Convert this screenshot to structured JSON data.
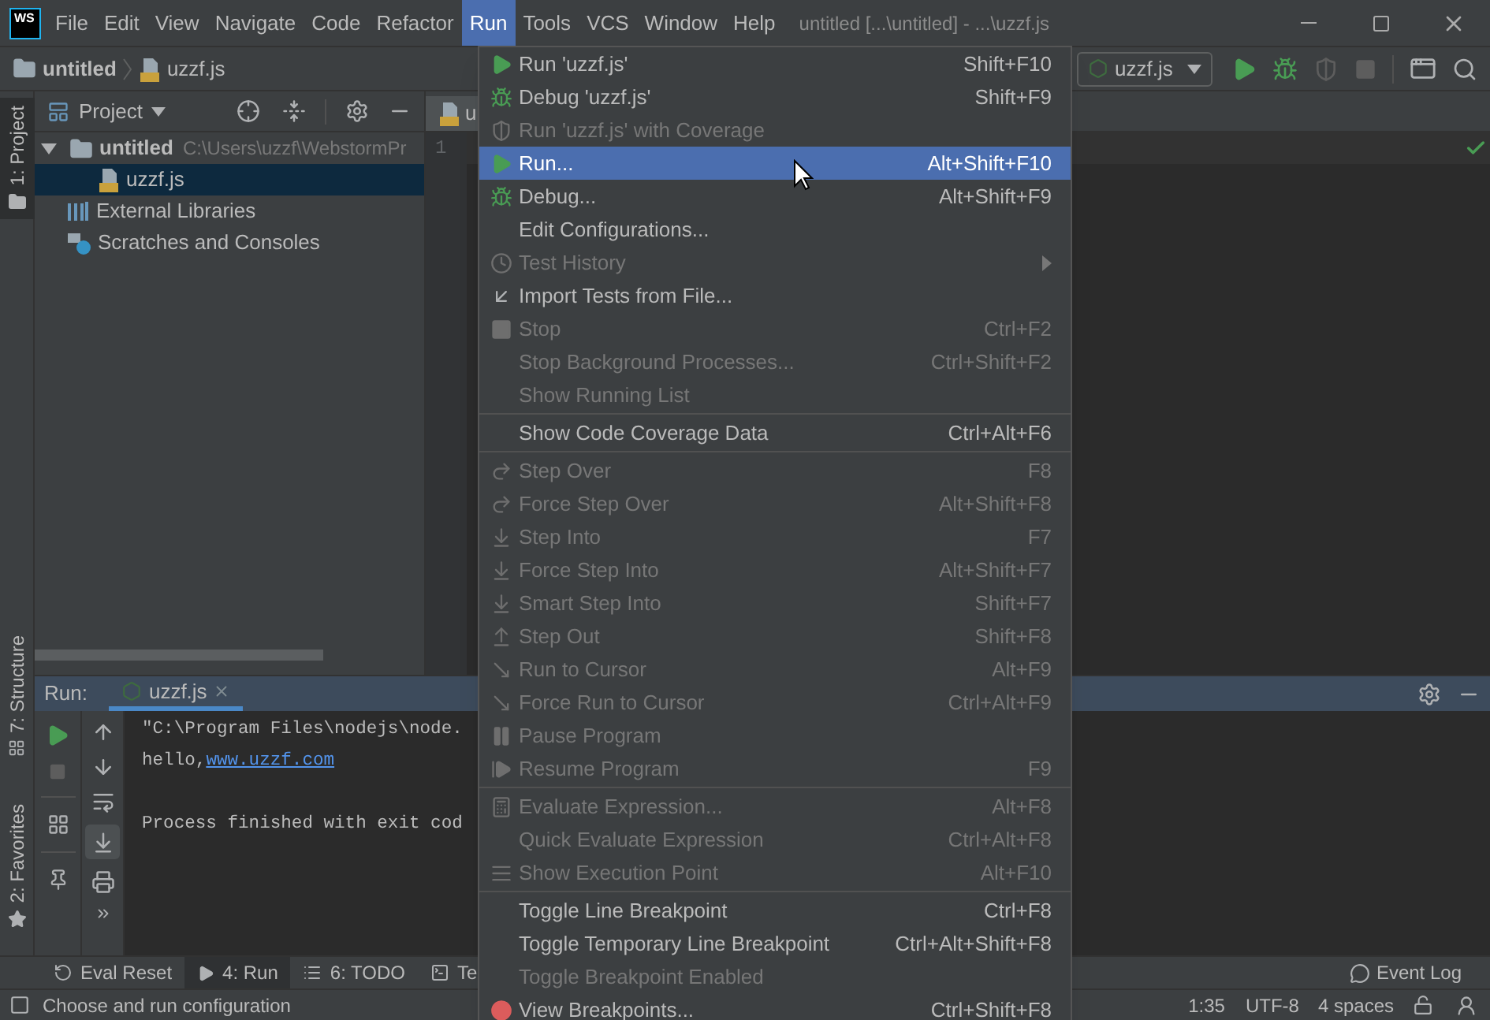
{
  "title_bar": {
    "logo": "WS",
    "menus": [
      {
        "label": "File",
        "selected": false
      },
      {
        "label": "Edit",
        "selected": false
      },
      {
        "label": "View",
        "selected": false
      },
      {
        "label": "Navigate",
        "selected": false
      },
      {
        "label": "Code",
        "selected": false
      },
      {
        "label": "Refactor",
        "selected": false
      },
      {
        "label": "Run",
        "selected": true
      },
      {
        "label": "Tools",
        "selected": false
      },
      {
        "label": "VCS",
        "selected": false
      },
      {
        "label": "Window",
        "selected": false
      },
      {
        "label": "Help",
        "selected": false
      }
    ],
    "title": "untitled [...\\untitled] - ...\\uzzf.js"
  },
  "nav_bar": {
    "breadcrumbs": [
      "untitled",
      "uzzf.js"
    ],
    "run_config": "uzzf.js"
  },
  "tool_strip": [
    {
      "label": "1: Project",
      "selected": true
    },
    {
      "label": "7: Structure",
      "selected": false
    },
    {
      "label": "2: Favorites",
      "selected": false
    }
  ],
  "project_panel": {
    "title": "Project",
    "tree": [
      {
        "label": "untitled",
        "path": "C:\\Users\\uzzf\\WebstormPr",
        "expanded": true,
        "selected": false,
        "children": [
          {
            "label": "uzzf.js",
            "selected": true
          }
        ]
      },
      {
        "label": "External Libraries",
        "selected": false
      },
      {
        "label": "Scratches and Consoles",
        "selected": false
      }
    ]
  },
  "editor": {
    "tab": "u",
    "line_numbers": [
      "1"
    ]
  },
  "run_panel": {
    "label": "Run:",
    "tab": "uzzf.js",
    "console": [
      {
        "kind": "text",
        "text": "\"C:\\Program Files\\nodejs\\node."
      },
      {
        "kind": "link",
        "text": "hello,",
        "link": "www.uzzf.com"
      },
      {
        "kind": "blank"
      },
      {
        "kind": "text",
        "text": "Process finished with exit cod"
      }
    ]
  },
  "bottom_bar": {
    "tools": [
      {
        "label": "Eval Reset",
        "selected": false
      },
      {
        "label": "4: Run",
        "selected": true
      },
      {
        "label": "6: TODO",
        "selected": false
      },
      {
        "label": "Te",
        "selected": false
      }
    ],
    "event_log": "Event Log"
  },
  "status_bar": {
    "message": "Choose and run configuration",
    "position": "1:35",
    "encoding": "UTF-8",
    "indent": "4 spaces"
  },
  "run_menu": {
    "sections": [
      {
        "items": [
          {
            "label": "Run 'uzzf.js'",
            "shortcut": "Shift+F10",
            "disabled": false,
            "selected": false,
            "submenu": false
          },
          {
            "label": "Debug 'uzzf.js'",
            "shortcut": "Shift+F9",
            "disabled": false,
            "selected": false,
            "submenu": false
          },
          {
            "label": "Run 'uzzf.js' with Coverage",
            "disabled": true,
            "selected": false,
            "submenu": false
          },
          {
            "label": "Run...",
            "shortcut": "Alt+Shift+F10",
            "disabled": false,
            "selected": true,
            "submenu": false
          },
          {
            "label": "Debug...",
            "shortcut": "Alt+Shift+F9",
            "disabled": false,
            "selected": false,
            "submenu": false
          },
          {
            "label": "Edit Configurations...",
            "disabled": false,
            "selected": false,
            "submenu": false
          },
          {
            "label": "Test History",
            "disabled": true,
            "selected": false,
            "submenu": true
          },
          {
            "label": "Import Tests from File...",
            "disabled": false,
            "selected": false,
            "submenu": false
          },
          {
            "label": "Stop",
            "shortcut": "Ctrl+F2",
            "disabled": true,
            "selected": false,
            "submenu": false
          },
          {
            "label": "Stop Background Processes...",
            "shortcut": "Ctrl+Shift+F2",
            "disabled": true,
            "selected": false,
            "submenu": false
          },
          {
            "label": "Show Running List",
            "disabled": true,
            "selected": false,
            "submenu": false
          }
        ]
      },
      {
        "items": [
          {
            "label": "Show Code Coverage Data",
            "shortcut": "Ctrl+Alt+F6",
            "disabled": false,
            "selected": false,
            "submenu": false
          }
        ]
      },
      {
        "items": [
          {
            "label": "Step Over",
            "shortcut": "F8",
            "disabled": true,
            "selected": false,
            "submenu": false
          },
          {
            "label": "Force Step Over",
            "shortcut": "Alt+Shift+F8",
            "disabled": true,
            "selected": false,
            "submenu": false
          },
          {
            "label": "Step Into",
            "shortcut": "F7",
            "disabled": true,
            "selected": false,
            "submenu": false
          },
          {
            "label": "Force Step Into",
            "shortcut": "Alt+Shift+F7",
            "disabled": true,
            "selected": false,
            "submenu": false
          },
          {
            "label": "Smart Step Into",
            "shortcut": "Shift+F7",
            "disabled": true,
            "selected": false,
            "submenu": false
          },
          {
            "label": "Step Out",
            "shortcut": "Shift+F8",
            "disabled": true,
            "selected": false,
            "submenu": false
          },
          {
            "label": "Run to Cursor",
            "shortcut": "Alt+F9",
            "disabled": true,
            "selected": false,
            "submenu": false
          },
          {
            "label": "Force Run to Cursor",
            "shortcut": "Ctrl+Alt+F9",
            "disabled": true,
            "selected": false,
            "submenu": false
          },
          {
            "label": "Pause Program",
            "disabled": true,
            "selected": false,
            "submenu": false
          },
          {
            "label": "Resume Program",
            "shortcut": "F9",
            "disabled": true,
            "selected": false,
            "submenu": false
          }
        ]
      },
      {
        "items": [
          {
            "label": "Evaluate Expression...",
            "shortcut": "Alt+F8",
            "disabled": true,
            "selected": false,
            "submenu": false
          },
          {
            "label": "Quick Evaluate Expression",
            "shortcut": "Ctrl+Alt+F8",
            "disabled": true,
            "selected": false,
            "submenu": false
          },
          {
            "label": "Show Execution Point",
            "shortcut": "Alt+F10",
            "disabled": true,
            "selected": false,
            "submenu": false
          }
        ]
      },
      {
        "items": [
          {
            "label": "Toggle Line Breakpoint",
            "shortcut": "Ctrl+F8",
            "disabled": false,
            "selected": false,
            "submenu": false
          },
          {
            "label": "Toggle Temporary Line Breakpoint",
            "shortcut": "Ctrl+Alt+Shift+F8",
            "disabled": false,
            "selected": false,
            "submenu": false
          },
          {
            "label": "Toggle Breakpoint Enabled",
            "disabled": true,
            "selected": false,
            "submenu": false
          },
          {
            "label": "View Breakpoints...",
            "shortcut": "Ctrl+Shift+F8",
            "disabled": false,
            "selected": false,
            "submenu": false
          }
        ]
      }
    ]
  }
}
